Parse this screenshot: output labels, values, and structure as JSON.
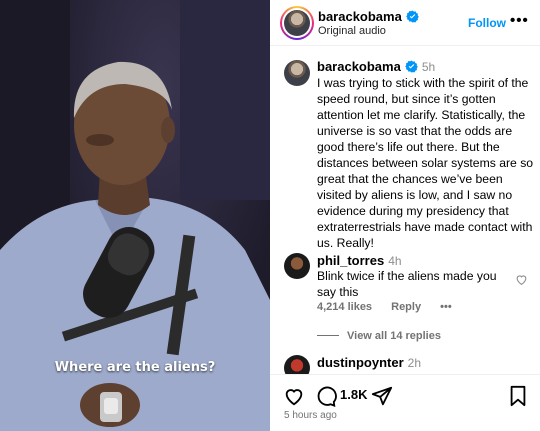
{
  "video": {
    "subtitle": "Where are the aliens?"
  },
  "header": {
    "username": "barackobama",
    "audio": "Original audio",
    "follow_label": "Follow",
    "more_label": "•••"
  },
  "caption": {
    "username": "barackobama",
    "time": "5h",
    "text": "I was trying to stick with the spirit of the speed round, but since it’s gotten attention let me clarify. Statistically, the universe is so vast that the odds are good there’s life out there. But the distances between solar systems are so great that the chances we’ve been visited by aliens is low, and I saw no evidence during my presidency that extraterrestrials have made contact with us. Really!"
  },
  "comments": [
    {
      "username": "phil_torres",
      "time": "4h",
      "text": "Blink twice if the aliens made you say this",
      "likes": "4,214 likes",
      "reply_label": "Reply",
      "more_label": "•••",
      "view_replies": "View all 14 replies"
    },
    {
      "username": "dustinpoynter",
      "time": "2h"
    }
  ],
  "actions": {
    "comment_count": "1.8K",
    "time_ago": "5 hours ago"
  },
  "colors": {
    "accent": "#0095f6",
    "verified": "#0095f6"
  }
}
